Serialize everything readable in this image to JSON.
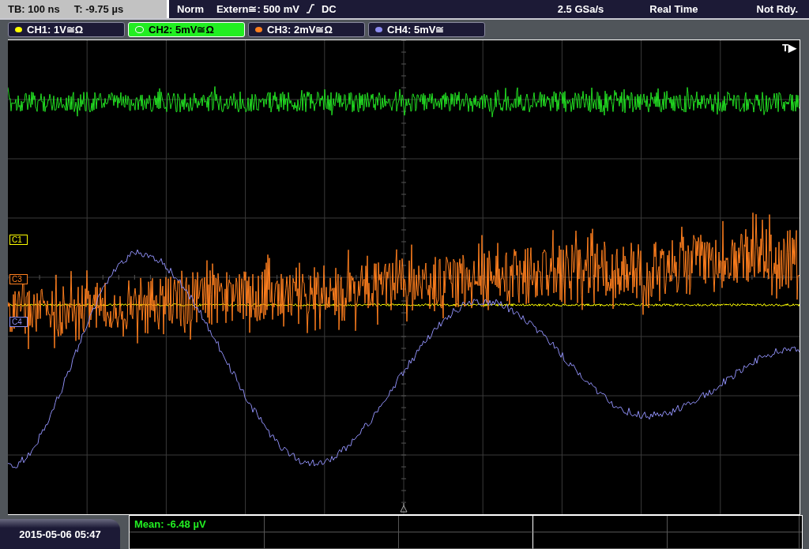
{
  "header": {
    "timebase": "TB: 100 ns",
    "trigger_time": "T: -9.75 µs",
    "mode": "Norm",
    "trigger_level": "Extern≅: 500 mV",
    "trigger_coupling": "DC",
    "sample_rate": "2.5 GSa/s",
    "acquisition": "Real Time",
    "status": "Not Rdy."
  },
  "channels": [
    {
      "label": "CH1: 1V≅Ω",
      "color": "#ffff00",
      "selected": false,
      "marker": "C1"
    },
    {
      "label": "CH2: 5mV≅Ω",
      "color": "#22dd22",
      "selected": true
    },
    {
      "label": "CH3: 2mV≅Ω",
      "color": "#ff7f1e",
      "selected": false,
      "marker": "C3"
    },
    {
      "label": "CH4: 5mV≅",
      "color": "#8c8cf0",
      "selected": false,
      "marker": "C4"
    }
  ],
  "trigger_marker": "T▶",
  "measurements": [
    {
      "text": "Mean: -6.48 µV"
    }
  ],
  "date": "2015-05-06 05:47"
}
